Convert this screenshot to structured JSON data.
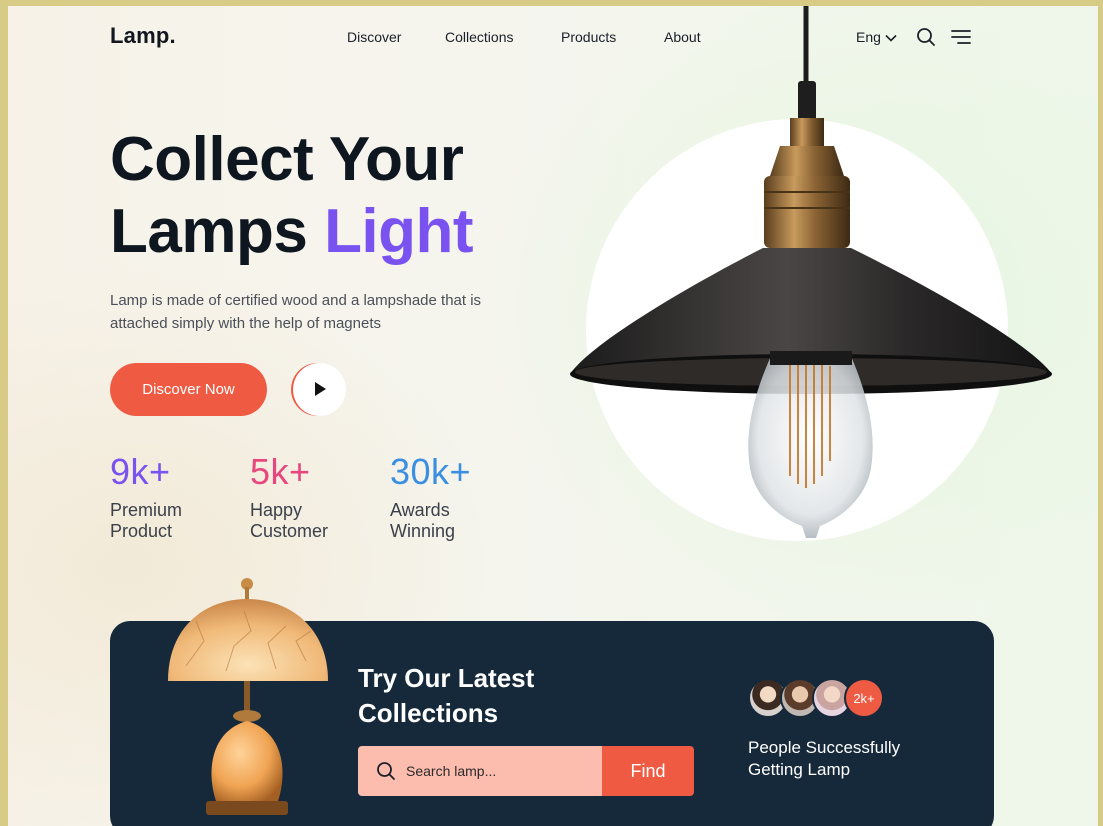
{
  "brand": {
    "logo": "Lamp."
  },
  "nav": {
    "links": [
      "Discover",
      "Collections",
      "Products",
      "About"
    ],
    "language": "Eng"
  },
  "icons": {
    "language_chevron": "chevron-down-icon",
    "search": "search-icon",
    "menu": "menu-icon",
    "play": "play-icon"
  },
  "hero": {
    "title_line1": "Collect Your",
    "title_line2_plain": "Lamps ",
    "title_line2_accent": "Light",
    "description": "Lamp is made of certified wood and a lampshade that is attached simply with the help of magnets",
    "primary_button": "Discover Now"
  },
  "stats": [
    {
      "value": "9k+",
      "label": "Premium\nProduct",
      "color": "#7a52f0"
    },
    {
      "value": "5k+",
      "label": "Happy\nCustomer",
      "color": "#e8467f"
    },
    {
      "value": "30k+",
      "label": "Awards\nWinning",
      "color": "#3b8fe0"
    }
  ],
  "promo": {
    "title": "Try Our Latest\nCollections",
    "search_placeholder": "Search lamp...",
    "search_button": "Find",
    "customer_count_badge": "2k+",
    "customers_text": "People Successfully\nGetting Lamp"
  },
  "colors": {
    "accent_purple": "#7a52f0",
    "accent_orange": "#ef5a43",
    "promo_bg": "#16293a"
  }
}
